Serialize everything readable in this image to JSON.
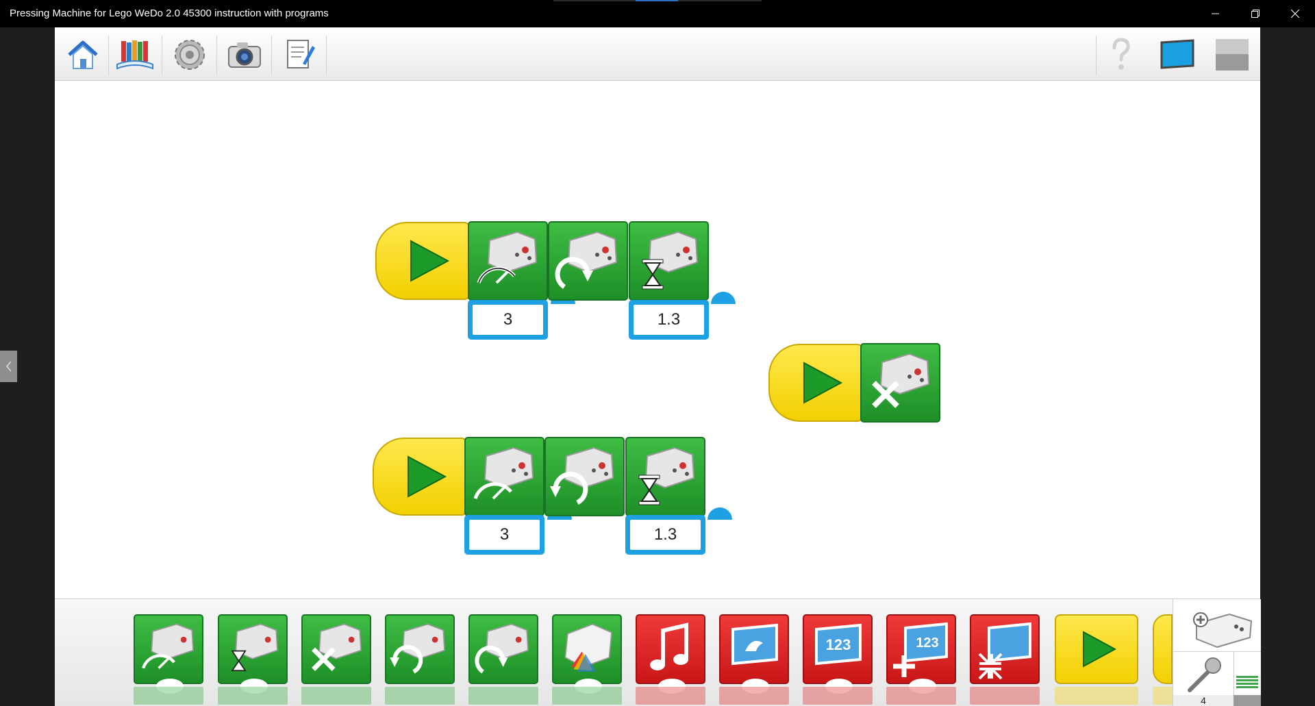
{
  "window": {
    "title": "Pressing Machine for Lego WeDo 2.0 45300 instruction with programs",
    "controls": [
      "minimize-icon",
      "restore-icon",
      "close-icon"
    ]
  },
  "toolbar": {
    "left_icons": [
      "home-icon",
      "library-icon",
      "settings-gear-icon",
      "camera-icon",
      "documentation-icon"
    ],
    "right_icons": [
      "help-icon",
      "display-icon",
      "stop-icon"
    ]
  },
  "program1": {
    "speed": "3",
    "wait": "1.3",
    "blocks": [
      "start-block",
      "motor-power-block",
      "motor-clockwise-block",
      "motor-on-for-block"
    ]
  },
  "program2": {
    "blocks": [
      "start-block",
      "motor-off-block"
    ]
  },
  "program3": {
    "speed": "3",
    "wait": "1.3",
    "blocks": [
      "start-block",
      "motor-power-block",
      "motor-counterclockwise-block",
      "motor-on-for-block"
    ]
  },
  "palette": {
    "blocks": [
      "motor-power",
      "motor-on-for",
      "motor-off",
      "motor-counterclockwise",
      "motor-clockwise",
      "light-color",
      "play-sound",
      "display-background",
      "display-number",
      "add-to-display",
      "display-small",
      "start",
      "more"
    ],
    "colors": {
      "motor": "#2ea836",
      "display": "#de2020",
      "start": "#f6d300"
    }
  },
  "devices": {
    "microphone_value": "4"
  }
}
